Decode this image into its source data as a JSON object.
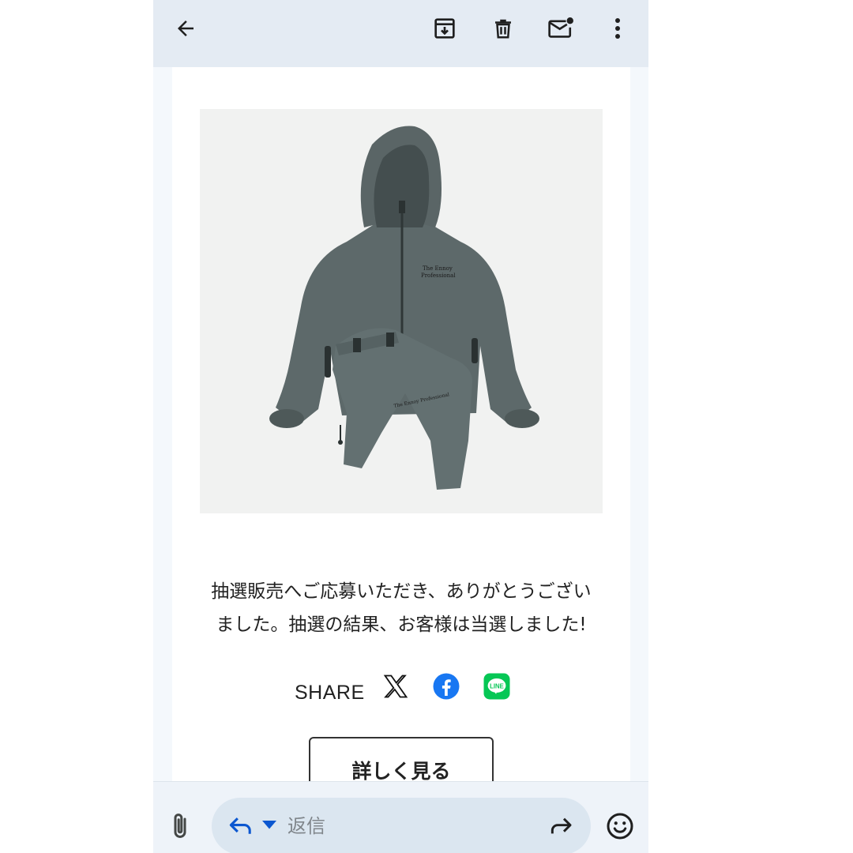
{
  "toolbar": {
    "back_icon": "arrow-left-icon",
    "archive_icon": "archive-icon",
    "delete_icon": "trash-icon",
    "mark_unread_icon": "mail-unread-icon",
    "more_icon": "more-vert-icon"
  },
  "email": {
    "image_alt": "The Ennoy Professional jacket and pants set in gray",
    "message_lines": [
      "抽選販売へご応募いただき、ありがとうござい",
      "ました。抽選の結果、お客様は当選しました!"
    ],
    "share": {
      "label": "SHARE",
      "icons": [
        "x-icon",
        "facebook-icon",
        "line-icon"
      ]
    },
    "details_button": "詳しく見る"
  },
  "reply_bar": {
    "attach_icon": "paperclip-icon",
    "reply_icon": "reply-icon",
    "placeholder": "返信",
    "forward_icon": "forward-icon",
    "emoji_icon": "emoji-icon"
  },
  "colors": {
    "toolbar_bg": "#e4ebf3",
    "reply_pill_bg": "#dbe6f0",
    "icon_dark": "#1f1f1f",
    "link_blue": "#0b57d0",
    "facebook_blue": "#1877f2",
    "line_green": "#06c755",
    "garment_gray": "#5f6b6c"
  }
}
